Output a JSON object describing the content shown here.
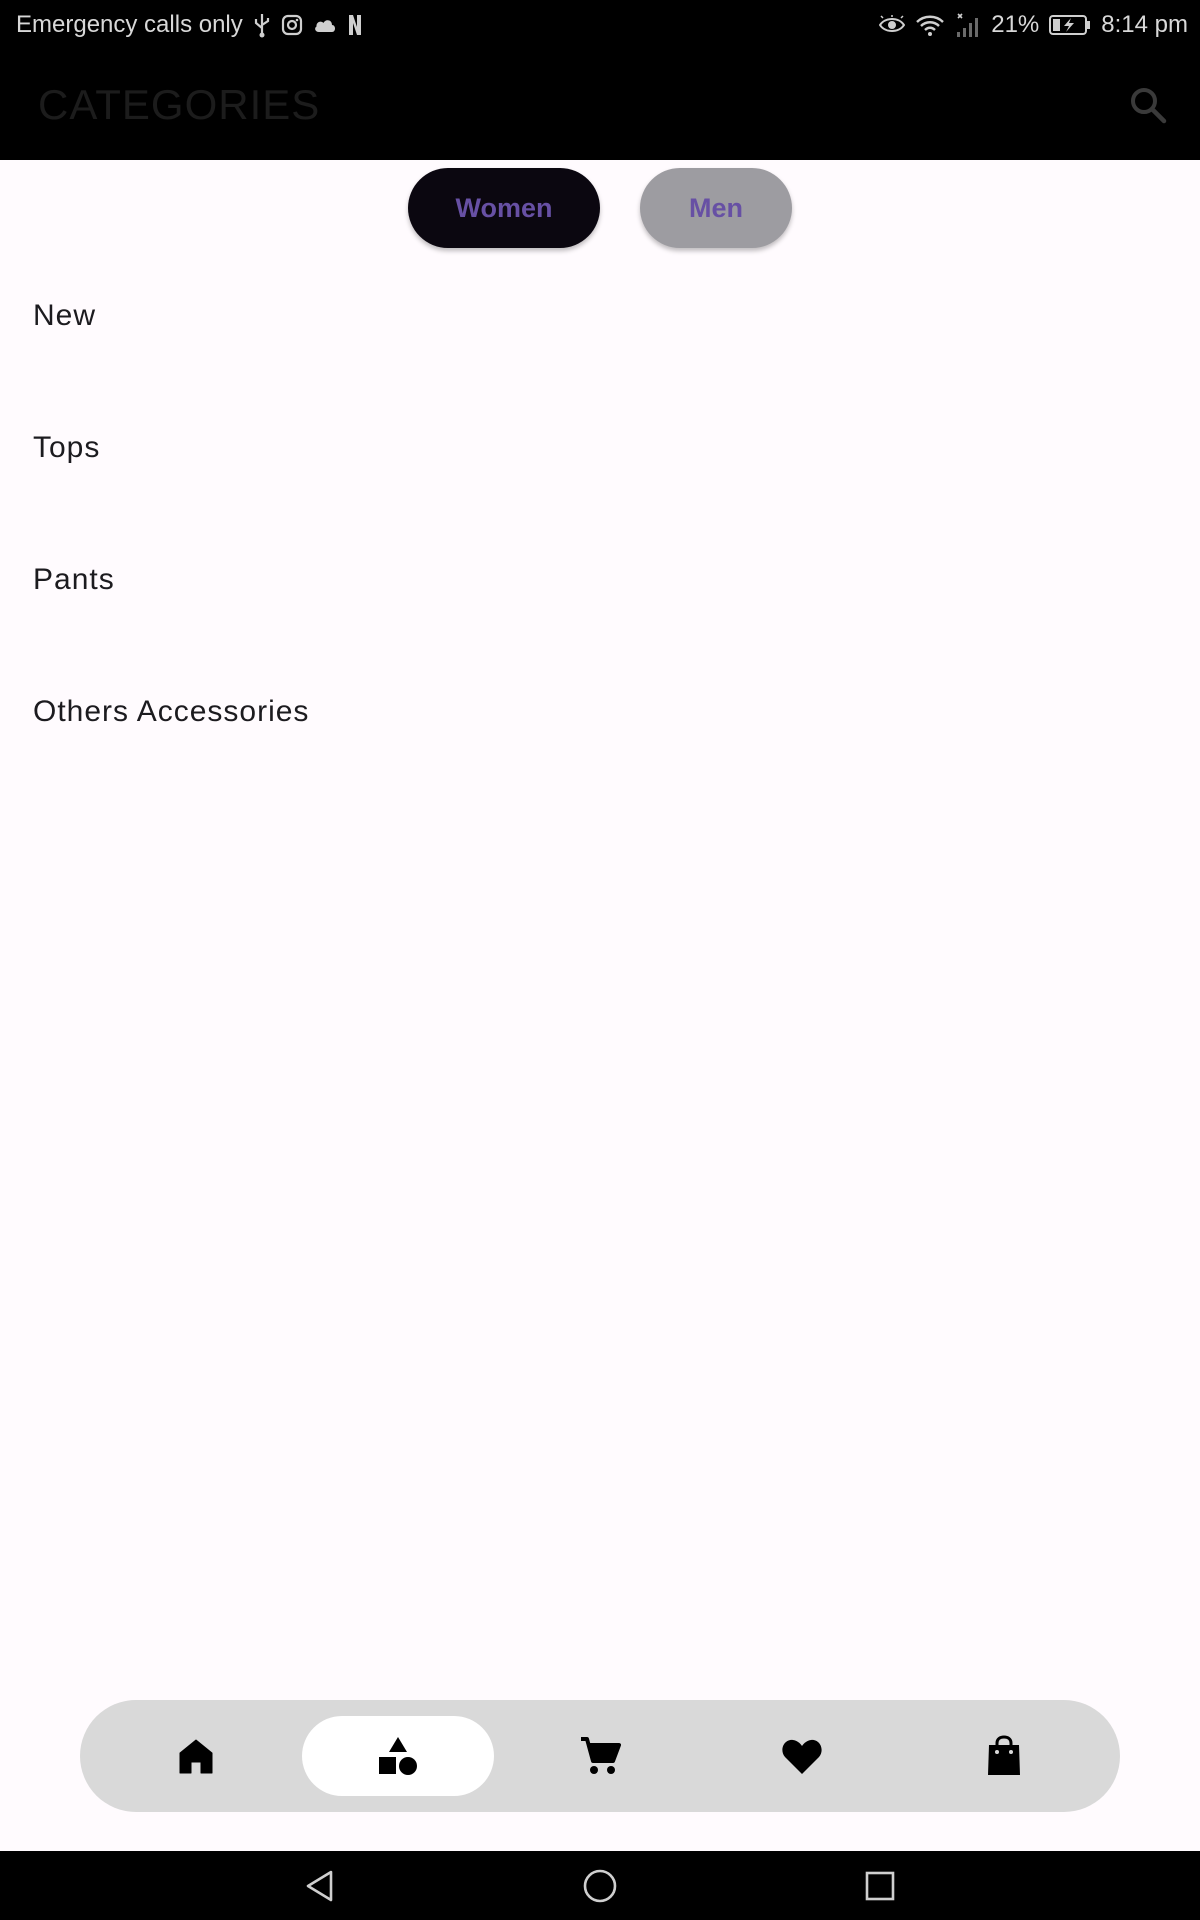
{
  "status_bar": {
    "carrier_text": "Emergency calls only",
    "battery": "21%",
    "time": "8:14 pm",
    "icons": [
      "usb-icon",
      "instagram-icon",
      "cloud-icon",
      "netflix-icon",
      "eye-icon",
      "wifi-icon",
      "signal-icon",
      "battery-charging-icon"
    ]
  },
  "app_bar": {
    "title": "CATEGORIES",
    "search_icon": "search-icon"
  },
  "gender_toggle": {
    "women_label": "Women",
    "men_label": "Men",
    "selected": "Women",
    "active_color": "#0b0710",
    "inactive_color": "#9d9ca1",
    "text_color": "#6750a4"
  },
  "categories": [
    {
      "label": "New"
    },
    {
      "label": "Tops"
    },
    {
      "label": "Pants"
    },
    {
      "label": "Others Accessories"
    }
  ],
  "bottom_nav": {
    "items": [
      {
        "icon": "home-icon",
        "active": false
      },
      {
        "icon": "shapes-icon",
        "active": true
      },
      {
        "icon": "cart-icon",
        "active": false
      },
      {
        "icon": "heart-icon",
        "active": false
      },
      {
        "icon": "shopping-bag-icon",
        "active": false
      }
    ]
  },
  "system_nav": {
    "icons": [
      "back-icon",
      "home-circle-icon",
      "recents-icon"
    ]
  }
}
